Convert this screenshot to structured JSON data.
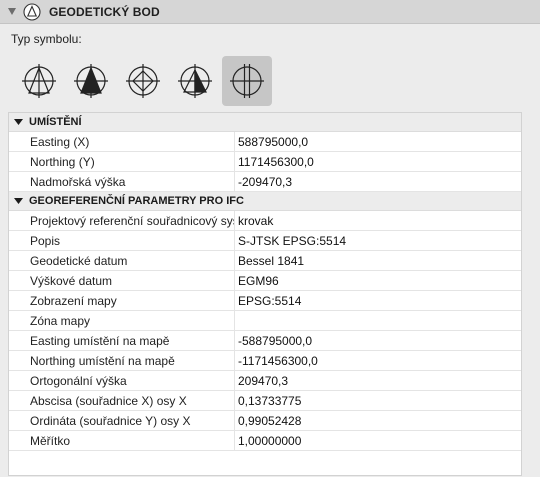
{
  "header": {
    "title": "GEODETICKÝ BOD",
    "icon": "survey-point-icon"
  },
  "symbol_label": "Typ symbolu:",
  "symbols": [
    {
      "icon": "survey-symbol-1-icon",
      "selected": false
    },
    {
      "icon": "survey-symbol-2-icon",
      "selected": false
    },
    {
      "icon": "survey-symbol-3-icon",
      "selected": false
    },
    {
      "icon": "survey-symbol-4-icon",
      "selected": false
    },
    {
      "icon": "survey-symbol-5-icon",
      "selected": true
    }
  ],
  "sections": [
    {
      "title": "UMÍSTĚNÍ",
      "rows": [
        {
          "label": "Easting (X)",
          "value": "588795000,0"
        },
        {
          "label": "Northing (Y)",
          "value": "1171456300,0"
        },
        {
          "label": "Nadmořská výška",
          "value": "-209470,3"
        }
      ]
    },
    {
      "title": "GEOREFERENČNÍ PARAMETRY PRO IFC",
      "rows": [
        {
          "label": "Projektový referenční souřadnicový systém",
          "value": "krovak"
        },
        {
          "label": "Popis",
          "value": "S-JTSK EPSG:5514"
        },
        {
          "label": "Geodetické datum",
          "value": "Bessel 1841"
        },
        {
          "label": "Výškové datum",
          "value": "EGM96"
        },
        {
          "label": "Zobrazení mapy",
          "value": "EPSG:5514"
        },
        {
          "label": "Zóna mapy",
          "value": ""
        },
        {
          "label": "Easting umístění na mapě",
          "value": "-588795000,0"
        },
        {
          "label": "Northing umístění na mapě",
          "value": "-1171456300,0"
        },
        {
          "label": "Ortogonální výška",
          "value": "209470,3"
        },
        {
          "label": "Abscisa (souřadnice X) osy X",
          "value": "0,13733775"
        },
        {
          "label": "Ordináta (souřadnice Y) osy X",
          "value": "0,99052428"
        },
        {
          "label": "Měřítko",
          "value": "1,00000000"
        }
      ]
    }
  ]
}
